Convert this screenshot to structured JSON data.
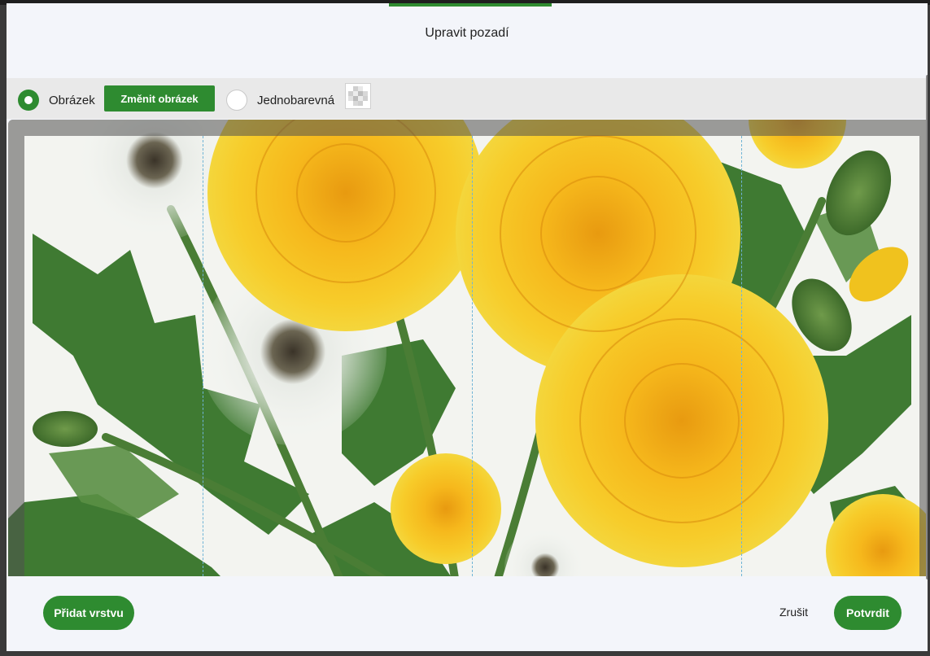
{
  "dialog": {
    "title": "Upravit pozadí"
  },
  "toolbar": {
    "image_option_label": "Obrázek",
    "change_image_label": "Změnit obrázek",
    "solid_color_option_label": "Jednobarevná",
    "selected_option": "Obrázek"
  },
  "canvas": {
    "image_subject": "dandelion-bouquet-illustration"
  },
  "footer": {
    "add_layer_label": "Přidat vrstvu",
    "cancel_label": "Zrušit",
    "confirm_label": "Potvrdit"
  },
  "colors": {
    "accent": "#2e8b30",
    "modal_background": "#f3f5fa",
    "toolbar_background": "#e9e9e9",
    "editor_background": "#6d6d6d",
    "guide_line": "#6fb4d6"
  }
}
